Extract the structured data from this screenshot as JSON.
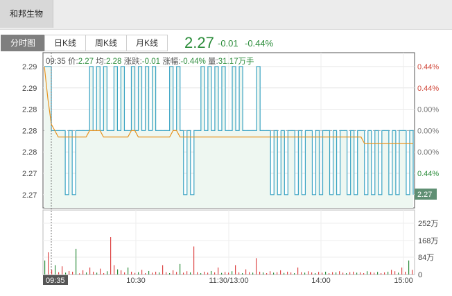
{
  "header": {
    "stock_name": "和邦生物"
  },
  "tabs": [
    {
      "label": "分时图",
      "active": true
    },
    {
      "label": "日K线",
      "active": false
    },
    {
      "label": "周K线",
      "active": false
    },
    {
      "label": "月K线",
      "active": false
    }
  ],
  "quote": {
    "price": "2.27",
    "change": "-0.01",
    "change_pct": "-0.44%"
  },
  "info": {
    "time": "09:35",
    "price_label": "价:",
    "price": "2.27",
    "avg_label": "均:",
    "avg": "2.28",
    "change_label": "涨跌:",
    "change": "-0.01",
    "pct_label": "涨幅:",
    "pct": "-0.44%",
    "volume_label": "量:",
    "volume": "31.17万手"
  },
  "current_price_tag": "2.27",
  "colors": {
    "price_line": "#3aa3c3",
    "avg_line": "#e8931e",
    "up": "#d0473a",
    "down": "#2b8c3a",
    "fill": "#eef7f1",
    "tag_bg": "#5f8f73"
  },
  "chart_data": {
    "type": "line",
    "title": "",
    "y_left_ticks": [
      "2.29",
      "2.29",
      "2.28",
      "2.28",
      "2.28",
      "2.27",
      "2.27"
    ],
    "y_right_ticks": [
      "0.44%",
      "0.44%",
      "0.00%",
      "0.00%",
      "0.00%",
      "0.44%",
      "%"
    ],
    "x_ticks": [
      "09:35",
      "10:30",
      "11:30/13:00",
      "14:00",
      "15:00"
    ],
    "volume_ticks": [
      "252万",
      "168万",
      "84万",
      "0"
    ],
    "price_levels": [
      2.27,
      2.28,
      2.29
    ],
    "series": [
      {
        "values": [
          2.29,
          2.29,
          2.28,
          2.28,
          2.28,
          2.28,
          2.27,
          2.28,
          2.27,
          2.28,
          2.28,
          2.28,
          2.28,
          2.29,
          2.28,
          2.29,
          2.28,
          2.29,
          2.28,
          2.28,
          2.29,
          2.28,
          2.29,
          2.28,
          2.28,
          2.29,
          2.28,
          2.29,
          2.28,
          2.29,
          2.28,
          2.29,
          2.28,
          2.28,
          2.28,
          2.28,
          2.29,
          2.28,
          2.29,
          2.28,
          2.27,
          2.28,
          2.27,
          2.28,
          2.28,
          2.29,
          2.28,
          2.29,
          2.28,
          2.29,
          2.28,
          2.29,
          2.28,
          2.28,
          2.29,
          2.28,
          2.29,
          2.28,
          2.28,
          2.28,
          2.28,
          2.29,
          2.28,
          2.28,
          2.28,
          2.27,
          2.28,
          2.27,
          2.28,
          2.27,
          2.28,
          2.28,
          2.27,
          2.28,
          2.27,
          2.28,
          2.28,
          2.27,
          2.28,
          2.27,
          2.28,
          2.28,
          2.27,
          2.28,
          2.27,
          2.28,
          2.28,
          2.27,
          2.28,
          2.27,
          2.28,
          2.28,
          2.27,
          2.28,
          2.27,
          2.28,
          2.27,
          2.28,
          2.28,
          2.27,
          2.28,
          2.27,
          2.28,
          2.28,
          2.27,
          2.28,
          2.27
        ]
      },
      {
        "values": [
          2.29,
          2.285,
          2.281,
          2.28,
          2.279,
          2.279,
          2.279,
          2.279,
          2.279,
          2.279,
          2.279,
          2.279,
          2.279,
          2.28,
          2.28,
          2.28,
          2.28,
          2.279,
          2.279,
          2.279,
          2.279,
          2.279,
          2.279,
          2.279,
          2.279,
          2.28,
          2.28,
          2.279,
          2.279,
          2.279,
          2.279,
          2.279,
          2.279,
          2.279,
          2.279,
          2.279,
          2.279,
          2.28,
          2.28,
          2.279,
          2.279,
          2.279,
          2.279,
          2.279,
          2.279,
          2.279,
          2.279,
          2.279,
          2.279,
          2.279,
          2.279,
          2.279,
          2.279,
          2.279,
          2.279,
          2.279,
          2.279,
          2.279,
          2.279,
          2.279,
          2.279,
          2.279,
          2.279,
          2.279,
          2.279,
          2.279,
          2.279,
          2.279,
          2.279,
          2.279,
          2.279,
          2.279,
          2.279,
          2.279,
          2.279,
          2.279,
          2.279,
          2.279,
          2.279,
          2.279,
          2.279,
          2.279,
          2.279,
          2.279,
          2.279,
          2.279,
          2.279,
          2.279,
          2.279,
          2.279,
          2.279,
          2.279,
          2.278,
          2.278,
          2.278,
          2.278,
          2.278,
          2.278,
          2.278,
          2.278,
          2.278,
          2.278,
          2.278,
          2.278,
          2.278,
          2.278,
          2.278
        ]
      }
    ],
    "volume": [
      60,
      95,
      20,
      40,
      10,
      35,
      8,
      15,
      12,
      110,
      5,
      18,
      9,
      30,
      12,
      8,
      25,
      6,
      14,
      160,
      40,
      22,
      18,
      9,
      30,
      12,
      7,
      10,
      20,
      6,
      15,
      8,
      12,
      9,
      40,
      10,
      6,
      18,
      11,
      45,
      8,
      14,
      9,
      120,
      10,
      6,
      12,
      8,
      15,
      9,
      30,
      7,
      11,
      8,
      14,
      40,
      9,
      6,
      22,
      10,
      8,
      70,
      12,
      9,
      6,
      14,
      8,
      10,
      18,
      7,
      12,
      9,
      6,
      30,
      10,
      8,
      14,
      9,
      6,
      11,
      8,
      12,
      6,
      10,
      9,
      14,
      8,
      6,
      10,
      12,
      8,
      9,
      6,
      14,
      10,
      8,
      11,
      6,
      9,
      12,
      20,
      14,
      8,
      30,
      12,
      60,
      20
    ]
  }
}
